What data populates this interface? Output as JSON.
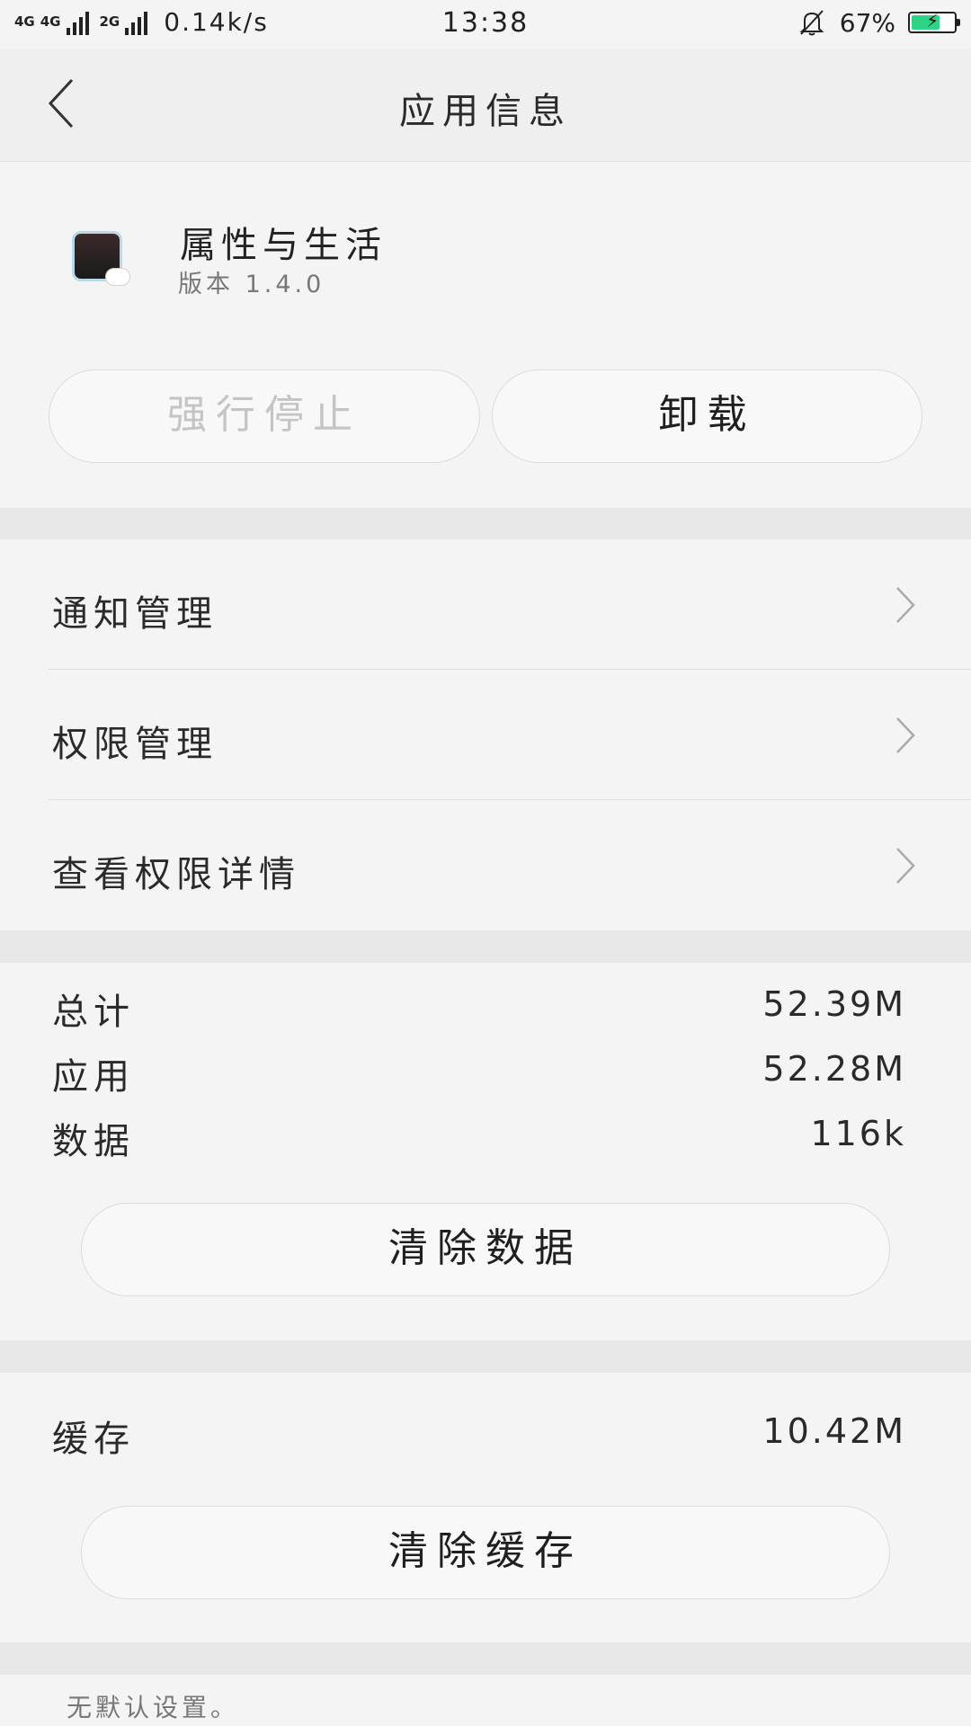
{
  "status_bar": {
    "network1": "4G",
    "network2": "4G",
    "network3": "2G",
    "speed": "0.14k/s",
    "time": "13:38",
    "battery_percent": "67%",
    "battery_level": 0.67,
    "battery_color": "#2fd386"
  },
  "header": {
    "title": "应用信息"
  },
  "app": {
    "name": "属性与生活",
    "version": "版本 1.4.0"
  },
  "actions": {
    "force_stop": "强行停止",
    "uninstall": "卸载"
  },
  "menu": {
    "items": [
      {
        "label": "通知管理"
      },
      {
        "label": "权限管理"
      },
      {
        "label": "查看权限详情"
      }
    ]
  },
  "storage": {
    "total_label": "总计",
    "total_value": "52.39M",
    "app_label": "应用",
    "app_value": "52.28M",
    "data_label": "数据",
    "data_value": "116k",
    "clear_data": "清除数据"
  },
  "cache": {
    "label": "缓存",
    "value": "10.42M",
    "clear_cache": "清除缓存"
  },
  "defaults": {
    "note": "无默认设置。"
  }
}
